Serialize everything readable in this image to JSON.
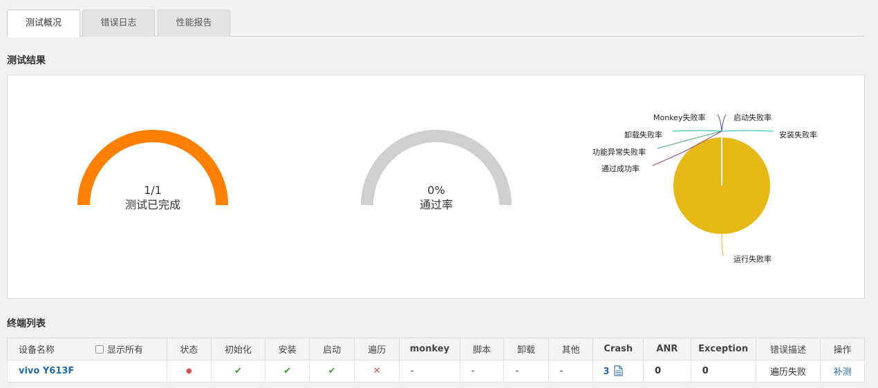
{
  "tabs": [
    {
      "label": "测试概况",
      "active": true
    },
    {
      "label": "错误日志",
      "active": false
    },
    {
      "label": "性能报告",
      "active": false
    }
  ],
  "results": {
    "title": "测试结果",
    "completion": {
      "value": "1/1",
      "label": "测试已完成",
      "fraction": 1.0,
      "color": "#ff7f00"
    },
    "pass_rate": {
      "value": "0%",
      "label": "通过率",
      "fraction": 0.0,
      "color": "#cfcfcf"
    }
  },
  "chart_data": {
    "type": "pie",
    "slices": [
      {
        "label": "启动失败率",
        "value": 0,
        "color": "#3b4fa8"
      },
      {
        "label": "安装失败率",
        "value": 0,
        "color": "#22b6c9"
      },
      {
        "label": "Monkey失败率",
        "value": 0,
        "color": "#2b58c4"
      },
      {
        "label": "卸载失败率",
        "value": 0,
        "color": "#1fb3a5"
      },
      {
        "label": "功能异常失败率",
        "value": 0,
        "color": "#3cb371"
      },
      {
        "label": "通过成功率",
        "value": 0,
        "color": "#9b3fa0"
      },
      {
        "label": "运行失败率",
        "value": 100,
        "color": "#e6b813"
      }
    ]
  },
  "devices": {
    "title": "终端列表",
    "show_all_label": "显示所有",
    "columns": [
      "设备名称",
      "状态",
      "初始化",
      "安装",
      "启动",
      "遍历",
      "monkey",
      "脚本",
      "卸载",
      "其他",
      "Crash",
      "ANR",
      "Exception",
      "错误描述",
      "操作"
    ],
    "rows": [
      {
        "name": "vivo Y613F",
        "status": "●",
        "init": "✔",
        "install": "✔",
        "launch": "✔",
        "traverse": "✕",
        "monkey": "-",
        "script": "-",
        "uninstall": "-",
        "other": "-",
        "crash": "3",
        "anr": "0",
        "exception": "0",
        "error_desc": "遍历失败",
        "action": "补测"
      }
    ]
  }
}
